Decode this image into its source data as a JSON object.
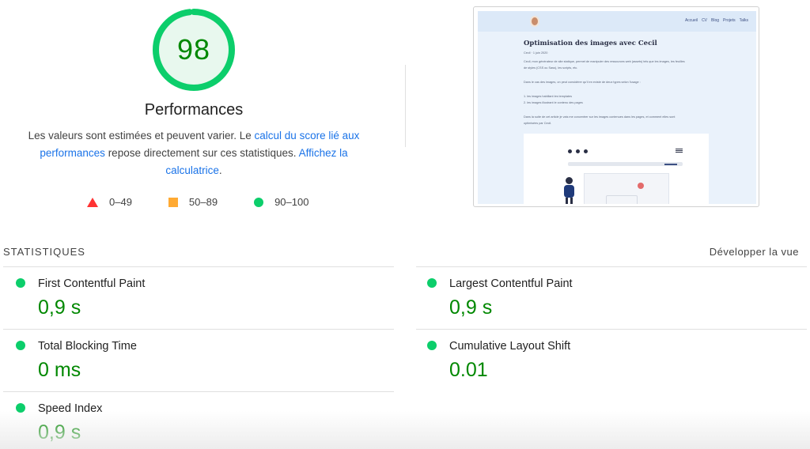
{
  "score": {
    "value": "98",
    "fraction": 0.98,
    "title": "Performances",
    "color": "#0cce6b",
    "text_color": "#008800"
  },
  "description": {
    "part1": "Les valeurs sont estimées et peuvent varier. Le ",
    "link1": "calcul du score lié aux performances",
    "part2": " repose directement sur ces statistiques. ",
    "link2": "Affichez la calculatrice",
    "part3": "."
  },
  "legend": [
    {
      "icon": "red-triangle-icon",
      "label": "0–49",
      "color": "#ff3333"
    },
    {
      "icon": "orange-square-icon",
      "label": "50–89",
      "color": "#ffaa33"
    },
    {
      "icon": "green-circle-icon",
      "label": "90–100",
      "color": "#0cce6b"
    }
  ],
  "thumbnail": {
    "nav_links": [
      "Accueil",
      "CV",
      "Blog",
      "Projets",
      "Talks"
    ],
    "title": "Optimisation des images avec Cecil",
    "meta": "Cecil · 1 juin 2020",
    "para1": "Cecil, mon générateur de site statique, permet de manipuler des ressources web (assets) tels que les images, les feuilles",
    "para1b": "de styles (CSS ou Sass), les scripts, etc.",
    "para2": "Dans le cas des images, on peut considérer qu'il en existe de deux types selon l'usage :",
    "list1": "1.  les images habillant les templates",
    "list2": "2.  les images illustrant le contenu des pages",
    "para3": "Dans la suite de cet article je vais me concentrer sur les images contenues dans les pages, et comment elles sont",
    "para3b": "optimisées par Cecil."
  },
  "stats": {
    "header": "STATISTIQUES",
    "expand_label": "Développer la vue",
    "metrics": [
      {
        "name": "First Contentful Paint",
        "value": "0,9 s",
        "status": "good"
      },
      {
        "name": "Largest Contentful Paint",
        "value": "0,9 s",
        "status": "good"
      },
      {
        "name": "Total Blocking Time",
        "value": "0 ms",
        "status": "good"
      },
      {
        "name": "Cumulative Layout Shift",
        "value": "0.01",
        "status": "good"
      },
      {
        "name": "Speed Index",
        "value": "0,9 s",
        "status": "good"
      }
    ]
  }
}
